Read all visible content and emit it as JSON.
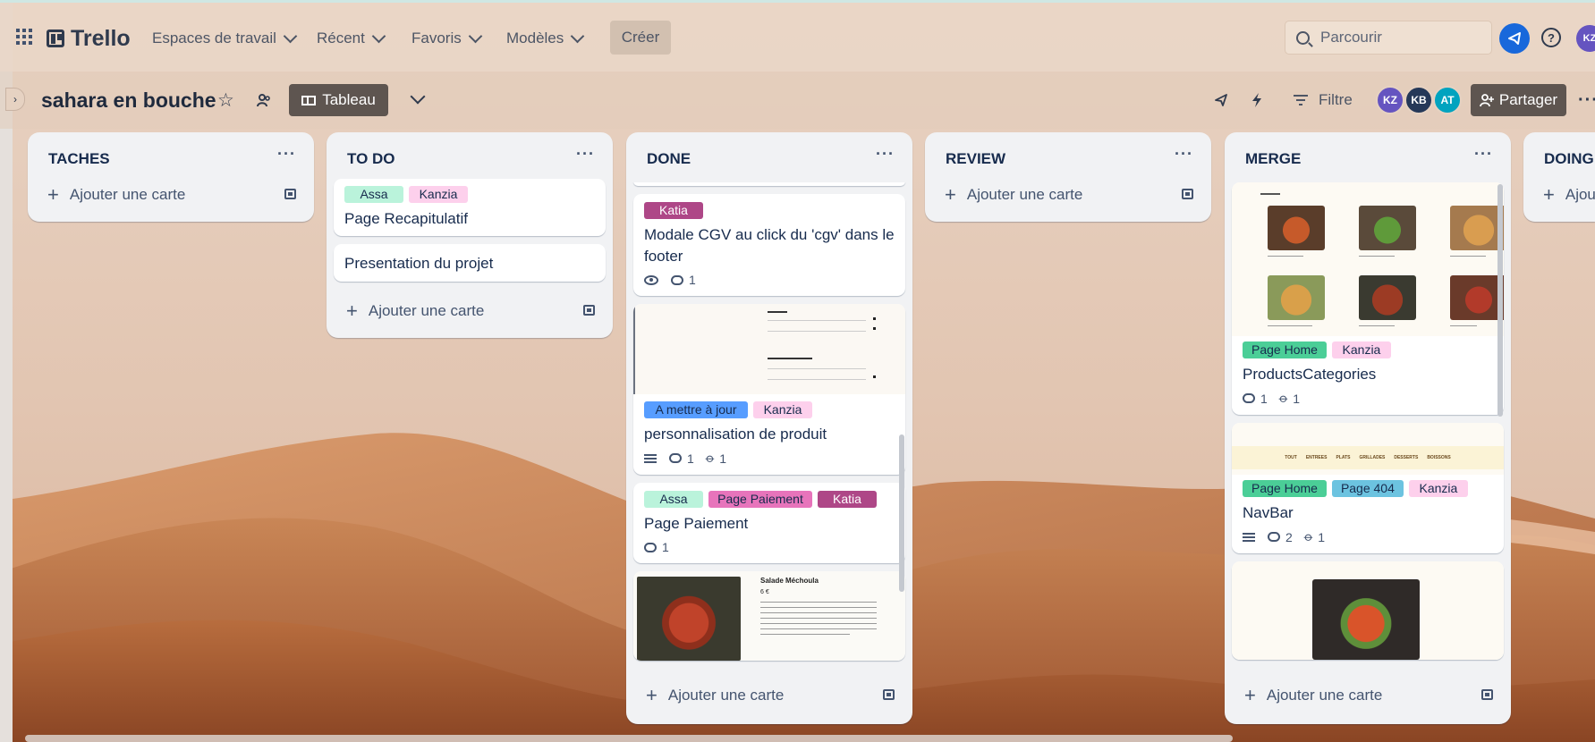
{
  "topnav": {
    "logo": "Trello",
    "menus": [
      {
        "label": "Espaces de travail"
      },
      {
        "label": "Récent"
      },
      {
        "label": "Favoris"
      },
      {
        "label": "Modèles"
      }
    ],
    "create_label": "Créer",
    "search_placeholder": "Parcourir",
    "user_initials": "KZ"
  },
  "boardbar": {
    "title": "sahara en bouche",
    "view_label": "Tableau",
    "filter_label": "Filtre",
    "share_label": "Partager",
    "members": [
      {
        "initials": "KZ",
        "color": "#6554c0"
      },
      {
        "initials": "KB",
        "color": "#253858"
      },
      {
        "initials": "AT",
        "color": "#00a3bf"
      }
    ]
  },
  "colors": {
    "label_assa": "#baf3db",
    "label_kanzia": "#fdd0ec",
    "label_katia": "#ae4787",
    "label_page_paiement": "#e774bb",
    "label_a_mettre": "#579dff",
    "label_page_home": "#4bce97",
    "label_page404": "#6cc3e0"
  },
  "lists": [
    {
      "title": "TACHES",
      "add_label": "Ajouter une carte"
    },
    {
      "title": "TO DO",
      "add_label": "Ajouter une carte",
      "cards": [
        {
          "labels": [
            "Assa",
            "Kanzia"
          ],
          "title": "Page Recapitulatif"
        },
        {
          "title": "Presentation du projet"
        }
      ]
    },
    {
      "title": "DONE",
      "add_label": "Ajouter une carte",
      "cards": [
        {
          "labels": [
            "Katia"
          ],
          "title": "Modale CGV au click du 'cgv' dans le footer",
          "comments": "1"
        },
        {
          "labels": [
            "A mettre à jour",
            "Kanzia"
          ],
          "title": "personnalisation de produit",
          "comments": "1",
          "attachments": "1"
        },
        {
          "labels": [
            "Assa",
            "Page Paiement",
            "Katia"
          ],
          "title": "Page Paiement",
          "comments": "1"
        },
        {
          "cover_title": "Salade Méchoula",
          "cover_price": "6 €"
        }
      ]
    },
    {
      "title": "REVIEW",
      "add_label": "Ajouter une carte"
    },
    {
      "title": "MERGE",
      "add_label": "Ajouter une carte",
      "cards": [
        {
          "labels": [
            "Page Home",
            "Kanzia"
          ],
          "title": "ProductsCategories",
          "comments": "1",
          "attachments": "1"
        },
        {
          "labels": [
            "Page Home",
            "Page 404",
            "Kanzia"
          ],
          "title": "NavBar",
          "comments": "2",
          "attachments": "1",
          "nav_items": [
            "TOUT",
            "ENTREES",
            "PLATS",
            "GRILLADES",
            "DESSERTS",
            "BOISSONS"
          ]
        }
      ]
    },
    {
      "title": "DOING",
      "add_label": "Ajou"
    }
  ]
}
